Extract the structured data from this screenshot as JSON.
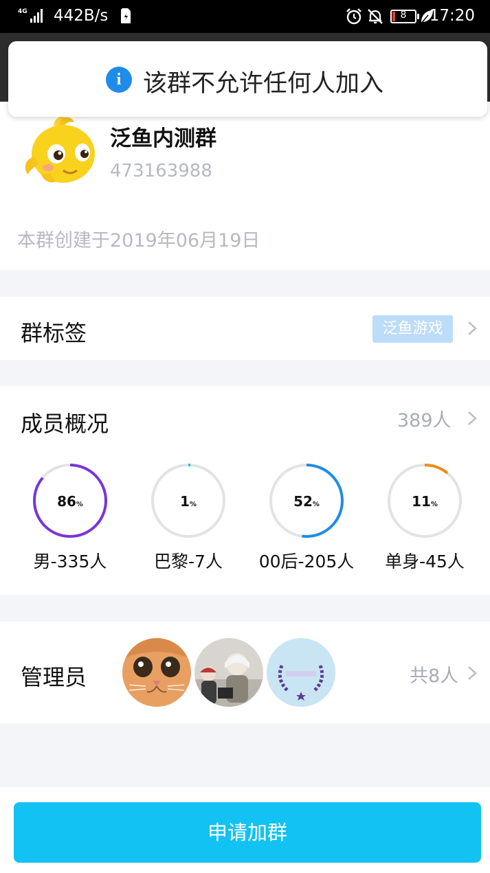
{
  "status_bar": {
    "network": "4G",
    "speed": "442B/s",
    "battery": "8",
    "time": "17:20"
  },
  "toast": {
    "message": "该群不允许任何人加入"
  },
  "group": {
    "name": "泛鱼内测群",
    "id": "473163988",
    "created": "本群创建于2019年06月19日"
  },
  "tags": {
    "title": "群标签",
    "tag": "泛鱼游戏"
  },
  "members": {
    "title": "成员概况",
    "count": "389人",
    "stats": [
      {
        "value": "86",
        "unit": "%",
        "label": "男-335人",
        "fraction": 0.86,
        "color": "#7a35d9"
      },
      {
        "value": "1",
        "unit": "%",
        "label": "巴黎-7人",
        "fraction": 0.01,
        "color": "#2dc7c7"
      },
      {
        "value": "52",
        "unit": "%",
        "label": "00后-205人",
        "fraction": 0.52,
        "color": "#1e8ce8"
      },
      {
        "value": "11",
        "unit": "%",
        "label": "单身-45人",
        "fraction": 0.11,
        "color": "#f08c1a"
      }
    ]
  },
  "admins": {
    "title": "管理员",
    "total": "共8人",
    "avatars": [
      "cat-avatar",
      "kids-avatar",
      "studio-avatar"
    ]
  },
  "apply_button": "申请加群"
}
